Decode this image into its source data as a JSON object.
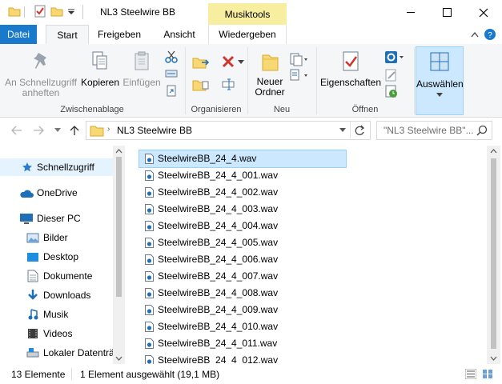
{
  "window": {
    "title": "NL3 Steelwire BB",
    "contextual_band": "Musiktools"
  },
  "tabs": [
    "Datei",
    "Start",
    "Freigeben",
    "Ansicht",
    "Wiedergeben"
  ],
  "ribbon": {
    "clipboard": {
      "pin": "An Schnellzugriff\nanheften",
      "copy": "Kopieren",
      "paste": "Einfügen",
      "label": "Zwischenablage"
    },
    "organize": {
      "label": "Organisieren"
    },
    "new": {
      "new_folder": "Neuer\nOrdner",
      "label": "Neu"
    },
    "open": {
      "properties": "Eigenschaften",
      "label": "Öffnen"
    },
    "select": {
      "select": "Auswählen"
    }
  },
  "address": {
    "path": "NL3 Steelwire BB",
    "search_placeholder": "\"NL3 Steelwire BB\"..."
  },
  "nav": {
    "quick_access": "Schnellzugriff",
    "onedrive": "OneDrive",
    "this_pc": "Dieser PC",
    "pictures": "Bilder",
    "desktop": "Desktop",
    "documents": "Dokumente",
    "downloads": "Downloads",
    "music": "Musik",
    "videos": "Videos",
    "local_drive": "Lokaler Datenträ"
  },
  "files": [
    "SteelwireBB_24_4.wav",
    "SteelwireBB_24_4_001.wav",
    "SteelwireBB_24_4_002.wav",
    "SteelwireBB_24_4_003.wav",
    "SteelwireBB_24_4_004.wav",
    "SteelwireBB_24_4_005.wav",
    "SteelwireBB_24_4_006.wav",
    "SteelwireBB_24_4_007.wav",
    "SteelwireBB_24_4_008.wav",
    "SteelwireBB_24_4_009.wav",
    "SteelwireBB_24_4_010.wav",
    "SteelwireBB_24_4_011.wav",
    "SteelwireBB_24_4_012.wav"
  ],
  "status": {
    "count": "13 Elemente",
    "selection": "1 Element ausgewählt (19,1 MB)"
  },
  "colors": {
    "accent": "#1979ca",
    "selection": "#cce8ff",
    "contextual": "#f7ef9f",
    "folder": "#f8d775"
  }
}
